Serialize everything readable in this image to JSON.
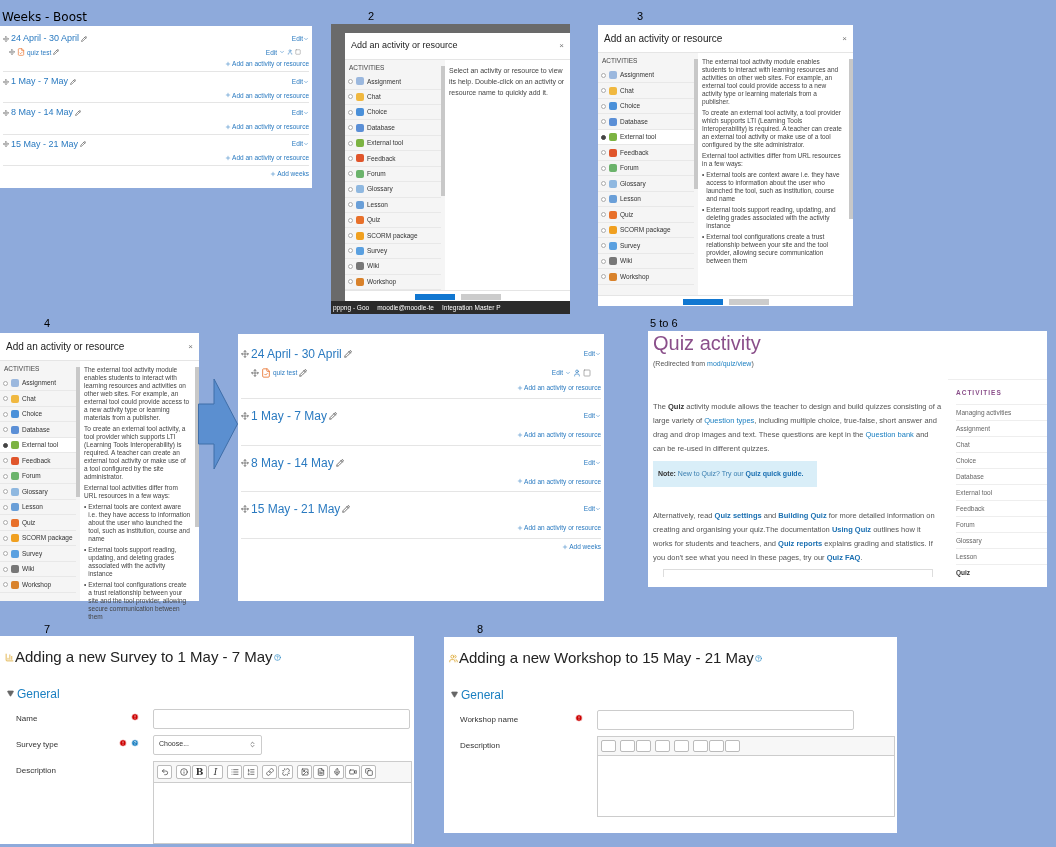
{
  "captions": [
    "Weeks - Boost",
    "2",
    "3",
    "4",
    "5 to 6",
    "7",
    "8"
  ],
  "weeks_small": {
    "sections": [
      {
        "title": "24 April - 30 April",
        "edit": "Edit",
        "activities": [
          {
            "name": "quiz test",
            "edit": "Edit"
          }
        ],
        "add": "Add an activity or resource"
      },
      {
        "title": "1 May - 7 May",
        "edit": "Edit",
        "add": "Add an activity or resource"
      },
      {
        "title": "8 May - 14 May",
        "edit": "Edit",
        "add": "Add an activity or resource"
      },
      {
        "title": "15 May - 21 May",
        "edit": "Edit",
        "add": "Add an activity or resource"
      }
    ],
    "add_weeks": "Add weeks"
  },
  "chooser_2": {
    "title": "Add an activity or resource",
    "close": "×",
    "heading": "ACTIVITIES",
    "items": [
      {
        "label": "Assignment",
        "selected": false,
        "color": "#9bb8de"
      },
      {
        "label": "Chat",
        "selected": false,
        "color": "#f0b840"
      },
      {
        "label": "Choice",
        "selected": false,
        "color": "#4a90d9"
      },
      {
        "label": "Database",
        "selected": false,
        "color": "#5b8fd6"
      },
      {
        "label": "External tool",
        "selected": false,
        "color": "#7cb342"
      },
      {
        "label": "Feedback",
        "selected": false,
        "color": "#e0552b"
      },
      {
        "label": "Forum",
        "selected": false,
        "color": "#6bb36b"
      },
      {
        "label": "Glossary",
        "selected": false,
        "color": "#8fb8e0"
      },
      {
        "label": "Lesson",
        "selected": false,
        "color": "#6a9fd8"
      },
      {
        "label": "Quiz",
        "selected": false,
        "color": "#e8702a"
      },
      {
        "label": "SCORM package",
        "selected": false,
        "color": "#f0a020"
      },
      {
        "label": "Survey",
        "selected": false,
        "color": "#5aa0e0"
      },
      {
        "label": "Wiki",
        "selected": false,
        "color": "#777777"
      },
      {
        "label": "Workshop",
        "selected": false,
        "color": "#d9822b"
      }
    ],
    "help_paragraphs": [
      "Select an activity or resource to view its help. Double-click on an activity or resource name to quickly add it."
    ],
    "taskbar": [
      "pppng - Goo",
      "moodle@moodle-te",
      "Integration Master P"
    ]
  },
  "chooser_3": {
    "title": "Add an activity or resource",
    "close": "×",
    "heading": "ACTIVITIES",
    "items": [
      {
        "label": "Assignment",
        "selected": false,
        "color": "#9bb8de"
      },
      {
        "label": "Chat",
        "selected": false,
        "color": "#f0b840"
      },
      {
        "label": "Choice",
        "selected": false,
        "color": "#4a90d9"
      },
      {
        "label": "Database",
        "selected": false,
        "color": "#5b8fd6"
      },
      {
        "label": "External tool",
        "selected": true,
        "color": "#7cb342"
      },
      {
        "label": "Feedback",
        "selected": false,
        "color": "#e0552b"
      },
      {
        "label": "Forum",
        "selected": false,
        "color": "#6bb36b"
      },
      {
        "label": "Glossary",
        "selected": false,
        "color": "#8fb8e0"
      },
      {
        "label": "Lesson",
        "selected": false,
        "color": "#6a9fd8"
      },
      {
        "label": "Quiz",
        "selected": false,
        "color": "#e8702a"
      },
      {
        "label": "SCORM package",
        "selected": false,
        "color": "#f0a020"
      },
      {
        "label": "Survey",
        "selected": false,
        "color": "#5aa0e0"
      },
      {
        "label": "Wiki",
        "selected": false,
        "color": "#777777"
      },
      {
        "label": "Workshop",
        "selected": false,
        "color": "#d9822b"
      }
    ],
    "help_paragraphs": [
      "The external tool activity module enables students to interact with learning resources and activities on other web sites. For example, an external tool could provide access to a new activity type or learning materials from a publisher.",
      "To create an external tool activity, a tool provider which supports LTI (Learning Tools Interoperability) is required. A teacher can create an external tool activity or make use of a tool configured by the site administrator.",
      "External tool activities differ from URL resources in a few ways:"
    ],
    "help_bullets": [
      {
        "bullet": "•",
        "text": "External tools are context aware i.e. they have access to information about the user who launched the tool, such as institution, course and name"
      },
      {
        "bullet": "•",
        "text": "External tools support reading, updating, and deleting grades associated with the activity instance"
      },
      {
        "bullet": "•",
        "text": "External tool configurations create a trust relationship between your site and the tool provider, allowing secure communication between them"
      }
    ]
  },
  "chooser_4": {
    "title": "Add an activity or resource",
    "close": "×",
    "heading": "ACTIVITIES",
    "items": [
      {
        "label": "Assignment",
        "selected": false,
        "color": "#9bb8de"
      },
      {
        "label": "Chat",
        "selected": false,
        "color": "#f0b840"
      },
      {
        "label": "Choice",
        "selected": false,
        "color": "#4a90d9"
      },
      {
        "label": "Database",
        "selected": false,
        "color": "#5b8fd6"
      },
      {
        "label": "External tool",
        "selected": true,
        "color": "#7cb342"
      },
      {
        "label": "Feedback",
        "selected": false,
        "color": "#e0552b"
      },
      {
        "label": "Forum",
        "selected": false,
        "color": "#6bb36b"
      },
      {
        "label": "Glossary",
        "selected": false,
        "color": "#8fb8e0"
      },
      {
        "label": "Lesson",
        "selected": false,
        "color": "#6a9fd8"
      },
      {
        "label": "Quiz",
        "selected": false,
        "color": "#e8702a"
      },
      {
        "label": "SCORM package",
        "selected": false,
        "color": "#f0a020"
      },
      {
        "label": "Survey",
        "selected": false,
        "color": "#5aa0e0"
      },
      {
        "label": "Wiki",
        "selected": false,
        "color": "#777777"
      },
      {
        "label": "Workshop",
        "selected": false,
        "color": "#d9822b"
      }
    ],
    "help_paragraphs": [
      "The external tool activity module enables students to interact with learning resources and activities on other web sites. For example, an external tool could provide access to a new activity type or learning materials from a publisher.",
      "To create an external tool activity, a tool provider which supports LTI (Learning Tools Interoperability) is required. A teacher can create an external tool activity or make use of a tool configured by the site administrator.",
      "External tool activities differ from URL resources in a few ways:"
    ],
    "help_bullets": [
      {
        "bullet": "•",
        "text": "External tools are context aware i.e. they have access to information about the user who launched the tool, such as institution, course and name"
      },
      {
        "bullet": "•",
        "text": "External tools support reading, updating, and deleting grades associated with the activity instance"
      },
      {
        "bullet": "•",
        "text": "External tool configurations create a trust relationship between your site and the tool provider, allowing secure communication between them"
      }
    ]
  },
  "weeks_large": {
    "sections": [
      {
        "title": "24 April - 30 April",
        "edit": "Edit",
        "activities": [
          {
            "name": "quiz test",
            "edit": "Edit"
          }
        ],
        "add": "Add an activity or resource"
      },
      {
        "title": "1 May - 7 May",
        "edit": "Edit",
        "add": "Add an activity or resource"
      },
      {
        "title": "8 May - 14 May",
        "edit": "Edit",
        "add": "Add an activity or resource"
      },
      {
        "title": "15 May - 21 May",
        "edit": "Edit",
        "add": "Add an activity or resource"
      }
    ],
    "add_weeks": "Add weeks"
  },
  "wiki": {
    "title": "Quiz activity",
    "redirect": [
      {
        "kind": "text",
        "text": "(Redirected from "
      },
      {
        "kind": "link",
        "text": "mod/quiz/view"
      },
      {
        "kind": "text",
        "text": ")"
      }
    ],
    "paragraphs": [
      [
        {
          "kind": "text",
          "text": "The "
        },
        {
          "kind": "bold",
          "text": "Quiz"
        },
        {
          "kind": "text",
          "text": " activity module allows the teacher to design and build quizzes consisting of a large variety of "
        },
        {
          "kind": "link",
          "text": "Question types"
        },
        {
          "kind": "text",
          "text": ", including multiple choice, true-false, short answer and drag and drop images and text. These questions are kept in the "
        },
        {
          "kind": "link",
          "text": "Question bank"
        },
        {
          "kind": "text",
          "text": " and can be re-used in different quizzes."
        }
      ],
      [
        {
          "kind": "text",
          "text": "Alternatively, read "
        },
        {
          "kind": "strong_link",
          "text": "Quiz settings"
        },
        {
          "kind": "text",
          "text": " and "
        },
        {
          "kind": "strong_link",
          "text": "Building Quiz"
        },
        {
          "kind": "text",
          "text": " for more detailed information on creating and organising your quiz.The documentation "
        },
        {
          "kind": "strong_link",
          "text": "Using Quiz"
        },
        {
          "kind": "text",
          "text": " outlines how it works for students and teachers, and "
        },
        {
          "kind": "strong_link",
          "text": "Quiz reports"
        },
        {
          "kind": "text",
          "text": " explains grading and statistics. If you don't see what you need in these pages, try our "
        },
        {
          "kind": "strong_link",
          "text": "Quiz FAQ"
        },
        {
          "kind": "text",
          "text": "."
        }
      ]
    ],
    "note": [
      {
        "kind": "bold",
        "text": "Note:"
      },
      {
        "kind": "text",
        "text": " New to Quiz? Try our "
      },
      {
        "kind": "strong_link",
        "text": "Quiz quick guide."
      }
    ],
    "sidebar": {
      "heading": "ACTIVITIES",
      "items": [
        {
          "label": "Managing activities",
          "selected": false
        },
        {
          "label": "Assignment",
          "selected": false
        },
        {
          "label": "Chat",
          "selected": false
        },
        {
          "label": "Choice",
          "selected": false
        },
        {
          "label": "Database",
          "selected": false
        },
        {
          "label": "External tool",
          "selected": false
        },
        {
          "label": "Feedback",
          "selected": false
        },
        {
          "label": "Forum",
          "selected": false
        },
        {
          "label": "Glossary",
          "selected": false
        },
        {
          "label": "Lesson",
          "selected": false
        },
        {
          "label": "Quiz",
          "selected": true
        }
      ]
    }
  },
  "form_survey": {
    "title": "Adding a new Survey to 1 May - 7 May",
    "section": "General",
    "expanded": true,
    "fields": [
      {
        "kind": "text",
        "label": "Name",
        "required": true,
        "help": false
      },
      {
        "kind": "select",
        "label": "Survey type",
        "required": true,
        "help": true,
        "value": "Choose..."
      },
      {
        "kind": "editor",
        "label": "Description",
        "required": false,
        "help": false,
        "toolbar": [
          [
            {
              "kind": "undo"
            }
          ],
          [
            {
              "kind": "info"
            },
            {
              "kind": "bold",
              "label": "B"
            },
            {
              "kind": "italic",
              "label": "I"
            }
          ],
          [
            {
              "kind": "bullets"
            },
            {
              "kind": "numbers"
            }
          ],
          [
            {
              "kind": "link"
            },
            {
              "kind": "unlink"
            }
          ],
          [
            {
              "kind": "image"
            },
            {
              "kind": "file"
            },
            {
              "kind": "mic"
            },
            {
              "kind": "video"
            },
            {
              "kind": "copy"
            }
          ]
        ]
      }
    ]
  },
  "form_workshop": {
    "title": "Adding a new Workshop to 15 May - 21 May",
    "section": "General",
    "expanded": true,
    "fields": [
      {
        "kind": "text",
        "label": "Workshop name",
        "required": true,
        "help": false
      },
      {
        "kind": "editor",
        "label": "Description",
        "required": false,
        "help": false,
        "toolbar": [
          [
            {
              "kind": "blank"
            }
          ],
          [
            {
              "kind": "blank"
            },
            {
              "kind": "blank"
            }
          ],
          [
            {
              "kind": "blank"
            }
          ],
          [
            {
              "kind": "blank"
            }
          ],
          [
            {
              "kind": "blank"
            },
            {
              "kind": "blank"
            },
            {
              "kind": "blank"
            }
          ]
        ]
      }
    ]
  }
}
